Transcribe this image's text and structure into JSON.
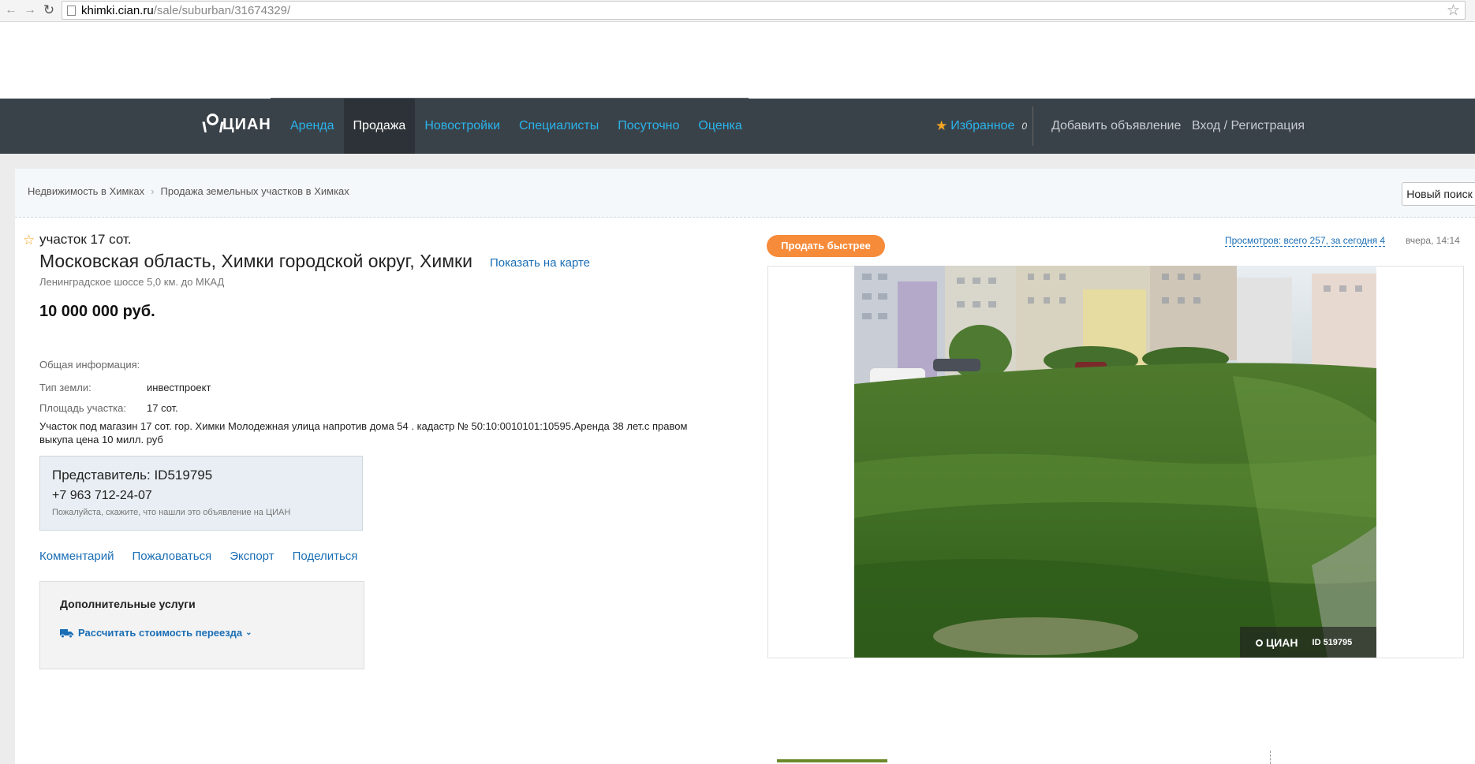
{
  "browser": {
    "url_host": "khimki.cian.ru",
    "url_path": "/sale/suburban/31674329/"
  },
  "header": {
    "logo_text": "ЦИАН",
    "nav": [
      "Аренда",
      "Продажа",
      "Новостройки",
      "Специалисты",
      "Посуточно",
      "Оценка"
    ],
    "active_nav": "Продажа",
    "favorites_label": "Избранное",
    "favorites_count": "0",
    "add_ad": "Добавить объявление",
    "login": "Вход / Регистрация",
    "colors": {
      "bar": "#3a4249",
      "link": "#2ab4ec",
      "star": "#f5a623"
    }
  },
  "breadcrumbs": [
    "Недвижимость в Химках",
    "Продажа земельных участков в Химках"
  ],
  "new_search": "Новый поиск",
  "listing": {
    "type": "участок 17 сот.",
    "address": "Московская область, Химки городской округ, Химки",
    "map_link": "Показать на карте",
    "highway": "Ленинградское шоссе 5,0 км. до МКАД",
    "price": "10 000 000 руб.",
    "info_title": "Общая информация:",
    "info": [
      {
        "label": "Тип земли:",
        "value": "инвестпроект"
      },
      {
        "label": "Площадь участка:",
        "value": "17 сот."
      }
    ],
    "description": "Участок под магазин 17 сот. гор. Химки Молодежная улица напротив дома 54 . кадастр № 50:10:0010101:10595.Аренда 38 лет.с правом выкупа цена 10 милл. руб"
  },
  "contact": {
    "rep": "Представитель: ID519795",
    "phone": "+7 963 712-24-07",
    "note": "Пожалуйста, скажите, что нашли это объявление на ЦИАН"
  },
  "actions": [
    "Комментарий",
    "Пожаловаться",
    "Экспорт",
    "Поделиться"
  ],
  "services": {
    "title": "Дополнительные услуги",
    "move_link": "Рассчитать стоимость переезда"
  },
  "right": {
    "sell_faster": "Продать быстрее",
    "views": "Просмотров: всего 257, за сегодня 4",
    "date": "вчера, 14:14",
    "watermark_logo": "ЦИАН",
    "watermark_id": "ID 519795",
    "accent": "#f68b3a"
  }
}
